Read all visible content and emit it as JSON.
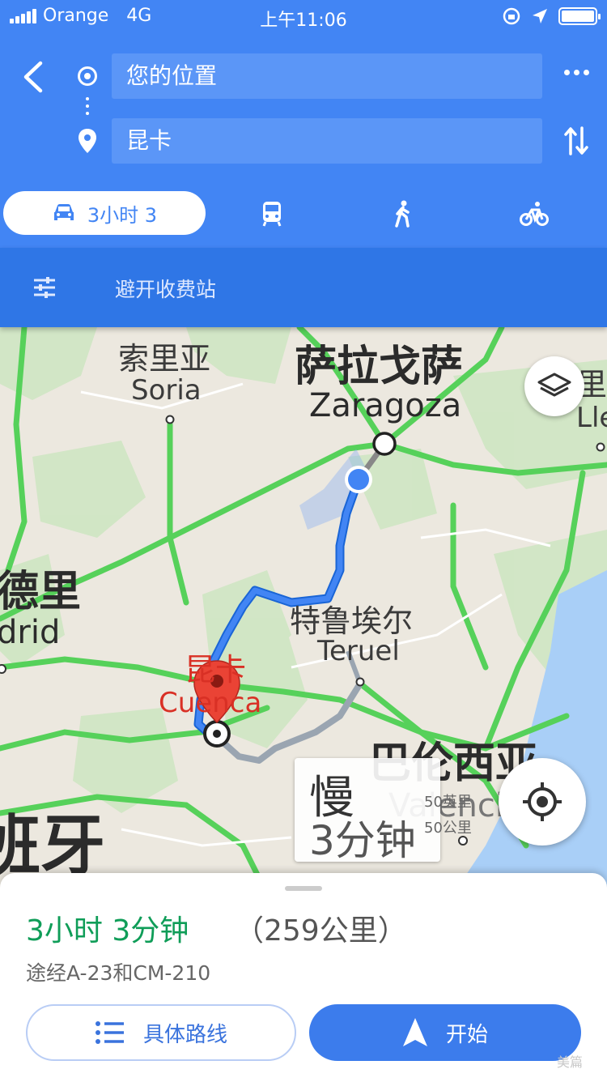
{
  "status_bar": {
    "carrier": "Orange",
    "network": "4G",
    "time": "上午11:06"
  },
  "directions": {
    "origin": "您的位置",
    "destination": "昆卡",
    "selected_mode_label": "3小时 3",
    "modes": [
      "car-icon",
      "transit-icon",
      "walk-icon",
      "bike-icon"
    ]
  },
  "options": {
    "avoid_tolls": "避开收费站"
  },
  "map": {
    "places": {
      "soria_cn": "索里亚",
      "soria_en": "Soria",
      "zaragoza_cn": "萨拉戈萨",
      "zaragoza_en": "Zaragoza",
      "madrid_cn": "德里",
      "madrid_en": "drid",
      "teruel_cn": "特鲁埃尔",
      "teruel_en": "Teruel",
      "cuenca_cn": "昆卡",
      "cuenca_en": "Cuenca",
      "valencia_cn": "巴伦西亚",
      "valencia_en": "Valencia",
      "spain_cn": "班牙",
      "lleida_cn": "里",
      "lleida_en": "Llei"
    },
    "traffic_callout": {
      "line1": "慢",
      "line2": "3分钟"
    },
    "scale": {
      "miles": "50英里",
      "km": "50公里"
    },
    "colors": {
      "route": "#4285f4",
      "alt_route": "#9aa5b1",
      "highway": "#56d15a",
      "water": "#a9cff7",
      "destination_pin": "#ea4335"
    }
  },
  "summary": {
    "duration": "3小时 3分钟",
    "distance": "（259公里）",
    "via": "途经A-23和CM-210",
    "steps_button": "具体路线",
    "start_button": "开始"
  },
  "watermark": "美篇"
}
